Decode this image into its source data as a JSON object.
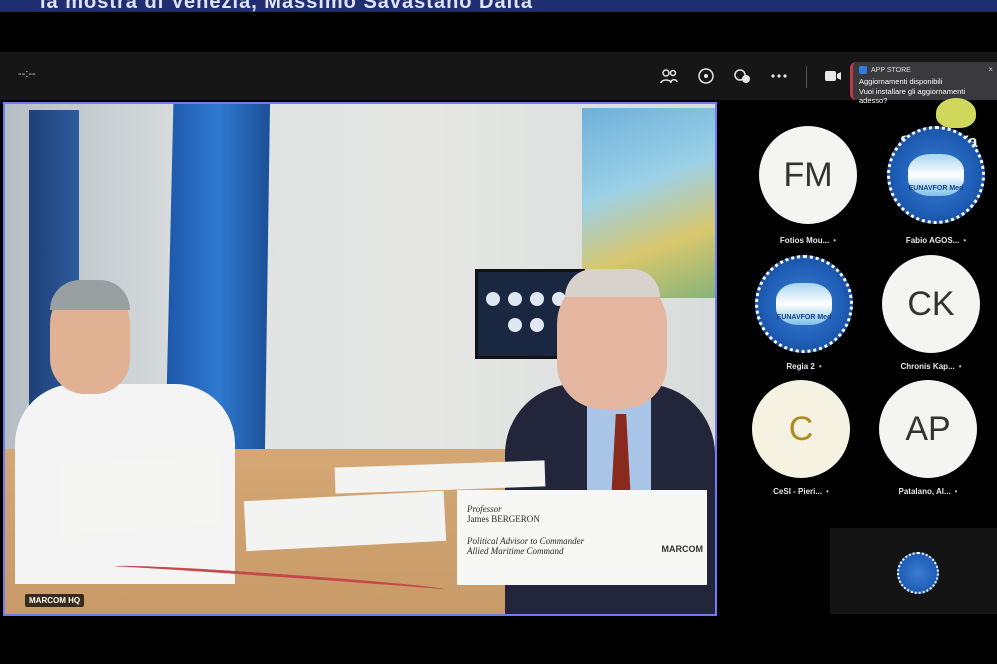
{
  "banner": {
    "text": "la mostra di Venezia, Massimo Savastano Daita"
  },
  "toolbar": {
    "timer": "--:--",
    "icons": [
      "participants-icon",
      "chat-icon",
      "reactions-icon",
      "more-icon",
      "camera-icon"
    ]
  },
  "toast": {
    "app": "APP STORE",
    "title": "Aggiornamenti disponibili",
    "body": "Vuoi installare gli aggiornamenti adesso?"
  },
  "main_video": {
    "caption": "MARCOM HQ",
    "nameplate": {
      "line1": "Professor",
      "line2": "James BERGERON",
      "line3": "Political Advisor to Commander",
      "line4": "Allied Maritime Command",
      "brand": "MARCOM"
    }
  },
  "participants": [
    {
      "initials": "FM",
      "name": "Fotios Mou..."
    },
    {
      "initials": "",
      "name": "Fabio AGOS...",
      "logo": "EUNAVFOR Med"
    },
    {
      "initials": "",
      "name": "Regia 2",
      "logo": "EUNAVFOR Med"
    },
    {
      "initials": "CK",
      "name": "Chronis Kap..."
    },
    {
      "initials": "C",
      "name": "CeSI - Pieri..."
    },
    {
      "initials": "AP",
      "name": "Patalano, Al..."
    }
  ],
  "watermark": "StreamYa",
  "colors": {
    "active_border": "#6e7ef0",
    "toast_accent": "#b83b4a",
    "logo_blue": "#1e5eb6"
  }
}
